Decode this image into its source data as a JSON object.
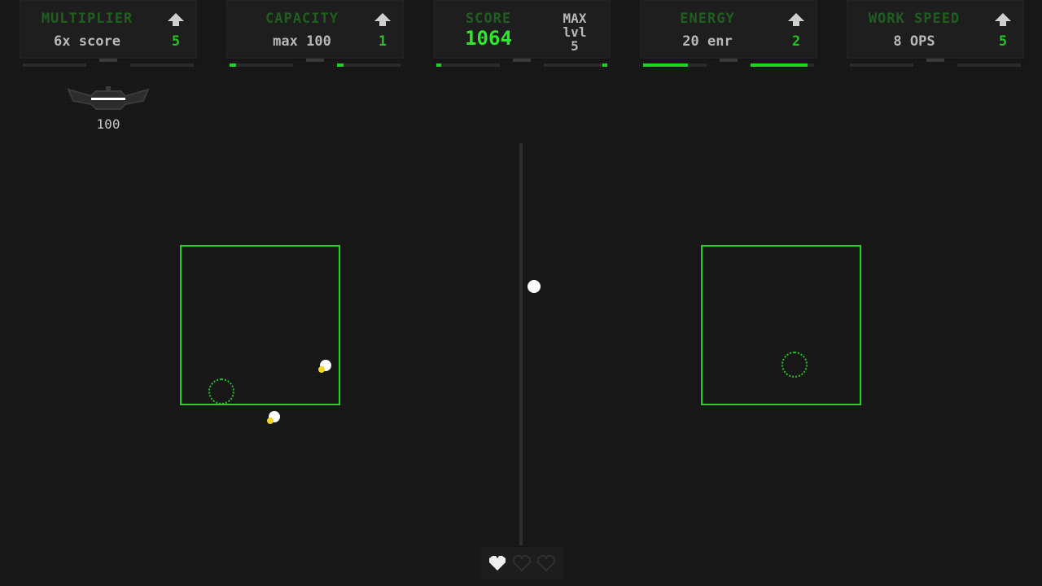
{
  "hud": {
    "panels": [
      {
        "title": "MULTIPLIER",
        "value": "6x score",
        "level": "5",
        "bar_fill_left": 0.0,
        "bar_fill_right": 0.0
      },
      {
        "title": "CAPACITY",
        "value": "max 100",
        "level": "1",
        "bar_fill_left": 0.1,
        "bar_fill_right": 0.1
      },
      {
        "title": "ENERGY",
        "value": "20 enr",
        "level": "2",
        "bar_fill_left": 0.7,
        "bar_fill_right": 0.9
      },
      {
        "title": "WORK SPEED",
        "value": "8 OPS",
        "level": "5",
        "bar_fill_left": 0.0,
        "bar_fill_right": 0.0
      }
    ],
    "score": {
      "title": "SCORE",
      "value": "1064"
    },
    "max_level": {
      "line1": "MAX",
      "line2": "lvl",
      "line3": "5"
    }
  },
  "ship": {
    "icon": "ship-icon",
    "count": "100"
  },
  "lives": {
    "filled": 1,
    "total": 3,
    "icon": "heart-icon"
  },
  "colors": {
    "accent": "#27d027",
    "title_dim": "#1f5e1f",
    "score": "#2ee82e",
    "background": "#161616",
    "text": "#b8b8b8"
  }
}
